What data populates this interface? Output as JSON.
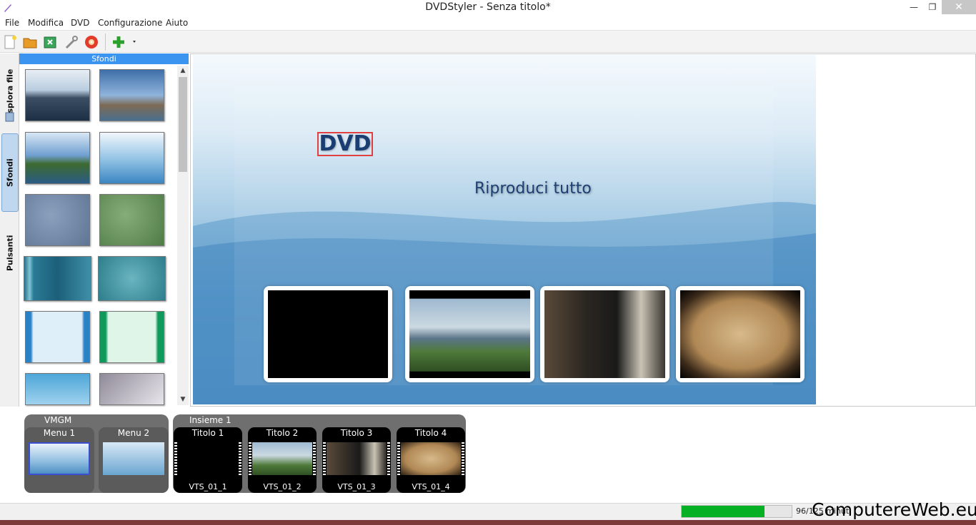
{
  "window": {
    "title": "DVDStyler - Senza titolo*"
  },
  "menu": [
    "File",
    "Modifica",
    "DVD",
    "Configurazione",
    "Aiuto"
  ],
  "toolbar": {
    "tools": [
      "new-icon",
      "open-icon",
      "save-icon",
      "settings-icon",
      "burn-icon",
      "add-icon"
    ]
  },
  "tabs": {
    "explore": "Esplora file",
    "backgrounds": "Sfondi",
    "buttons": "Pulsanti"
  },
  "sidebar": {
    "header": "Sfondi"
  },
  "canvas": {
    "dvd_text": "DVD",
    "play_all": "Riproduci tutto"
  },
  "titleset": {
    "vmgm": {
      "label": "VMGM",
      "menus": [
        "Menu 1",
        "Menu 2"
      ]
    },
    "set": {
      "label": "Insieme 1",
      "titles": [
        {
          "label": "Titolo 1",
          "file": "VTS_01_1"
        },
        {
          "label": "Titolo 2",
          "file": "VTS_01_2"
        },
        {
          "label": "Titolo 3",
          "file": "VTS_01_3"
        },
        {
          "label": "Titolo 4",
          "file": "VTS_01_4"
        }
      ]
    }
  },
  "status": {
    "progress": 0.75,
    "text": "96/125 minuti"
  },
  "watermark": "ComputereWeb.eu",
  "colors": {
    "accent": "#3b94f0",
    "progress": "#06b025"
  }
}
